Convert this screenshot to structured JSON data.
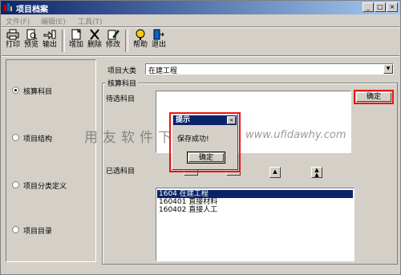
{
  "window": {
    "title": "项目档案",
    "controls": {
      "minimize": "_",
      "maximize": "□",
      "close": "×"
    }
  },
  "menu": [
    "文件(F)",
    "编辑(E)",
    "工具(T)"
  ],
  "toolbar": [
    {
      "label": "打印",
      "icon": "printer-icon"
    },
    {
      "label": "预览",
      "icon": "preview-icon"
    },
    {
      "label": "输出",
      "icon": "export-icon"
    },
    {
      "label": "增加",
      "icon": "add-icon"
    },
    {
      "label": "删除",
      "icon": "delete-icon"
    },
    {
      "label": "修改",
      "icon": "edit-icon"
    },
    {
      "label": "帮助",
      "icon": "help-icon"
    },
    {
      "label": "退出",
      "icon": "exit-icon"
    }
  ],
  "left_options": [
    {
      "label": "核算科目",
      "selected": true
    },
    {
      "label": "项目结构",
      "selected": false
    },
    {
      "label": "项目分类定义",
      "selected": false
    },
    {
      "label": "项目目录",
      "selected": false
    }
  ],
  "project_category": {
    "label": "项目大类",
    "value": "在建工程"
  },
  "group_title": "核算科目",
  "pending_label": "待选科目",
  "selected_label": "已选科目",
  "confirm_button": "确定",
  "selected_list": [
    {
      "text": "1604 在建工程",
      "highlighted": true
    },
    {
      "text": "160401 直接材料",
      "highlighted": false
    },
    {
      "text": "160402 直接人工",
      "highlighted": false
    }
  ],
  "dialog": {
    "title": "提示",
    "message": "保存成功!",
    "ok": "确定"
  },
  "watermark": {
    "cn": "用友软件下载",
    "url": "www.ufidawhy.com"
  },
  "colors": {
    "highlight": "#e11",
    "title_blue": "#0a246a",
    "face": "#d4d0c8"
  }
}
